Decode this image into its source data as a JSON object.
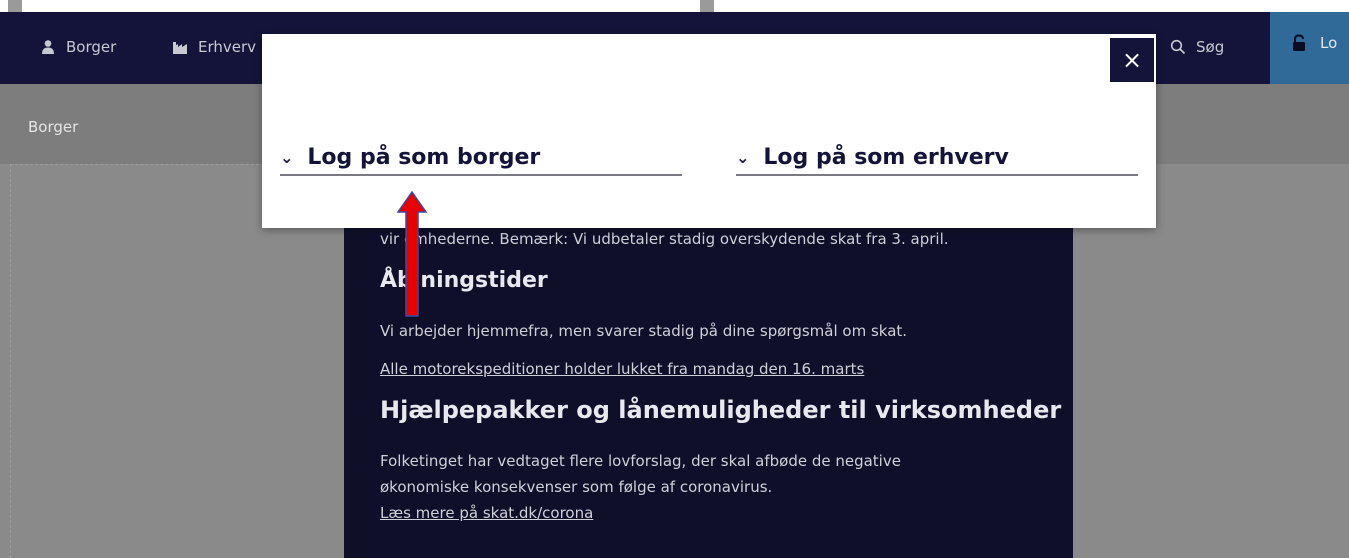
{
  "nav": {
    "items": [
      {
        "label": "Borger",
        "icon": "person-icon"
      },
      {
        "label": "Erhverv",
        "icon": "factory-icon"
      }
    ],
    "search_label": "Søg",
    "login_label": "Lo"
  },
  "breadcrumb": {
    "label": "Borger"
  },
  "modal": {
    "close_glyph": "×",
    "accordions": [
      {
        "label": "Log på som borger"
      },
      {
        "label": "Log på som erhverv"
      }
    ]
  },
  "content": {
    "intro_tail": "vir omhederne. Bemærk: Vi udbetaler stadig overskydende skat fra 3. april.",
    "heading1": "Åb ningstider",
    "para1": "Vi arbejder hjemmefra, men svarer stadig på dine spørgsmål om skat.",
    "link1": "Alle motorekspeditioner holder lukket fra mandag den 16. marts",
    "heading2": "Hjælpepakker og lånemuligheder til virksomheder",
    "para2_line1": "Folketinget har vedtaget flere lovforslag, der skal afbøde de negative",
    "para2_line2": "økonomiske konsekvenser som følge af coronavirus.",
    "link2": "Læs mere på skat.dk/corona"
  },
  "colors": {
    "navy": "#14143a",
    "login_blue": "#2f6a99",
    "arrow_red": "#e80000"
  }
}
